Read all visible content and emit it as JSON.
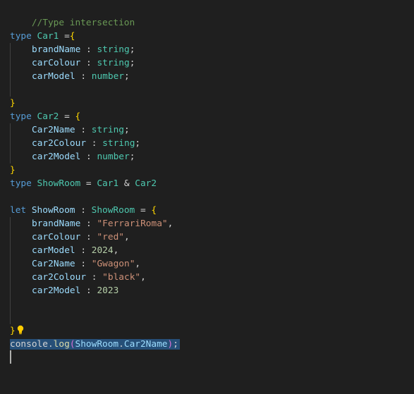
{
  "editor": {
    "comment": "//Type intersection",
    "car1": {
      "kw": "type",
      "name": "Car1",
      "eq": " =",
      "open": "{",
      "fields": [
        {
          "name": "brandName",
          "type": "string"
        },
        {
          "name": "carColour",
          "type": "string"
        },
        {
          "name": "carModel",
          "type": "number"
        }
      ],
      "close": "}"
    },
    "car2": {
      "kw": "type",
      "name": "Car2",
      "eq": " = ",
      "open": "{",
      "fields": [
        {
          "name": "Car2Name",
          "type": "string"
        },
        {
          "name": "car2Colour",
          "type": "string"
        },
        {
          "name": "car2Model",
          "type": "number"
        }
      ],
      "close": "}"
    },
    "showroom_type": {
      "kw": "type",
      "name": "ShowRoom",
      "eq": " = ",
      "a": "Car1",
      "amp": " & ",
      "b": "Car2"
    },
    "showroom_var": {
      "kw": "let",
      "name": "ShowRoom",
      "colon": " : ",
      "type": "ShowRoom",
      "eq": " = ",
      "open": "{",
      "fields": [
        {
          "name": "brandName",
          "value": "\"FerrariRoma\"",
          "kind": "str",
          "comma": ","
        },
        {
          "name": "carColour",
          "value": "\"red\"",
          "kind": "str",
          "comma": ","
        },
        {
          "name": "carModel",
          "value": "2024",
          "kind": "num",
          "comma": ","
        },
        {
          "name": "Car2Name",
          "value": "\"Gwagon\"",
          "kind": "str",
          "comma": ","
        },
        {
          "name": "car2Colour",
          "value": "\"black\"",
          "kind": "str",
          "comma": ","
        },
        {
          "name": "car2Model",
          "value": "2023",
          "kind": "num",
          "comma": ""
        }
      ],
      "close": "}"
    },
    "console_line": {
      "obj": "console",
      "dot": ".",
      "fn": "log",
      "lparen": "(",
      "arg_obj": "ShowRoom",
      "dot2": ".",
      "arg_prop": "Car2Name",
      "rparen": ")",
      "semi": ";"
    },
    "lightbulb_icon": "lightbulb-icon"
  },
  "colors": {
    "background": "#1f1f1f",
    "keyword": "#569cd6",
    "type": "#4ec9b0",
    "property": "#9cdcfe",
    "string": "#ce9178",
    "number": "#b5cea8",
    "comment": "#6a9955",
    "brace": "#ffd700",
    "selection": "#264f78"
  }
}
